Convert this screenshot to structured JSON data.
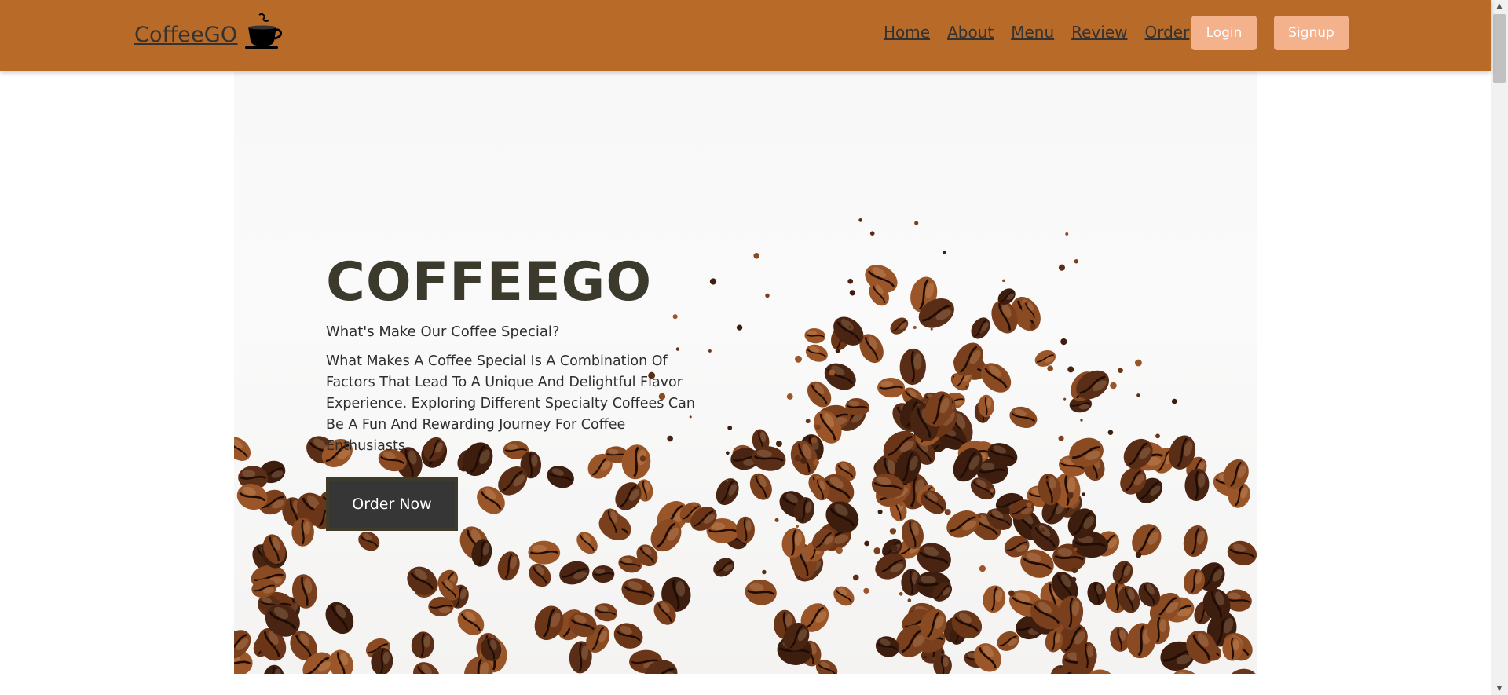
{
  "navbar": {
    "brand": "CoffeeGO",
    "links": [
      "Home",
      "About",
      "Menu",
      "Review",
      "Order"
    ],
    "login_label": "Login",
    "signup_label": "Signup"
  },
  "hero": {
    "title": "COFFEEGO",
    "subtitle": "What's Make Our Coffee Special?",
    "text": "What Makes A Coffee Special Is A Combination Of Factors That Lead To A Unique And Delightful Flavor Experience. Exploring Different Specialty Coffees Can Be A Fun And Rewarding Journey For Coffee Enthusiasts.",
    "button_label": "Order Now"
  },
  "colors": {
    "navbar": "#b86a28",
    "nav_button": "#f3b18c",
    "order_button": "#363636",
    "title": "#3b3a2c"
  }
}
